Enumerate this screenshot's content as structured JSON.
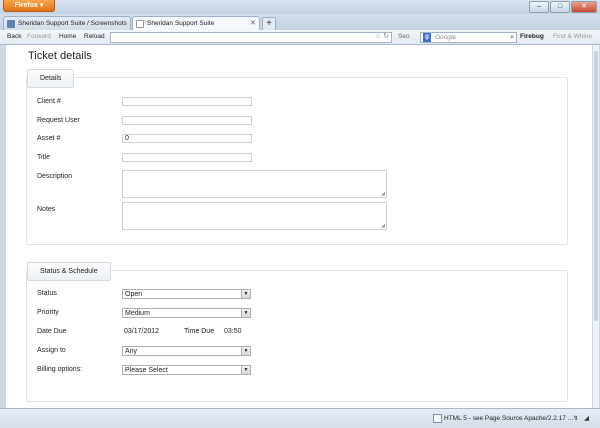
{
  "browser": {
    "app_button": "Firefox",
    "tabs": [
      {
        "label": "Sheridan Support Suite / Screenshots"
      },
      {
        "label": "Sheridan Support Suite"
      }
    ],
    "new_tab": "+",
    "nav": {
      "back": "Back",
      "forward": "Forward",
      "home": "Home",
      "reload": "Reload",
      "seo": "Seo",
      "search_placeholder": "Google",
      "firebug": "Firebug",
      "find": "Find & Whine"
    }
  },
  "page": {
    "title": "Ticket details",
    "details": {
      "legend": "Details",
      "client_label": "Client #",
      "client_value": "",
      "request_user_label": "Request User",
      "request_user_value": "",
      "asset_label": "Asset #",
      "asset_value": "0",
      "title_label": "Title",
      "title_value": "",
      "description_label": "Description",
      "notes_label": "Notes"
    },
    "status_schedule": {
      "legend": "Status & Schedule",
      "status_label": "Status",
      "status_value": "Open",
      "priority_label": "Priority",
      "priority_value": "Medium",
      "date_due_label": "Date Due",
      "date_due_value": "03/17/2012",
      "time_due_label": "Time Due",
      "time_due_value": "03:50",
      "assign_to_label": "Assign to",
      "assign_to_value": "Any",
      "billing_label": "Billing options:",
      "billing_value": "Please Select"
    }
  },
  "statusbar": {
    "html5": "HTML 5 - see Page Source",
    "server": "Apache/2.2.17 ..."
  }
}
